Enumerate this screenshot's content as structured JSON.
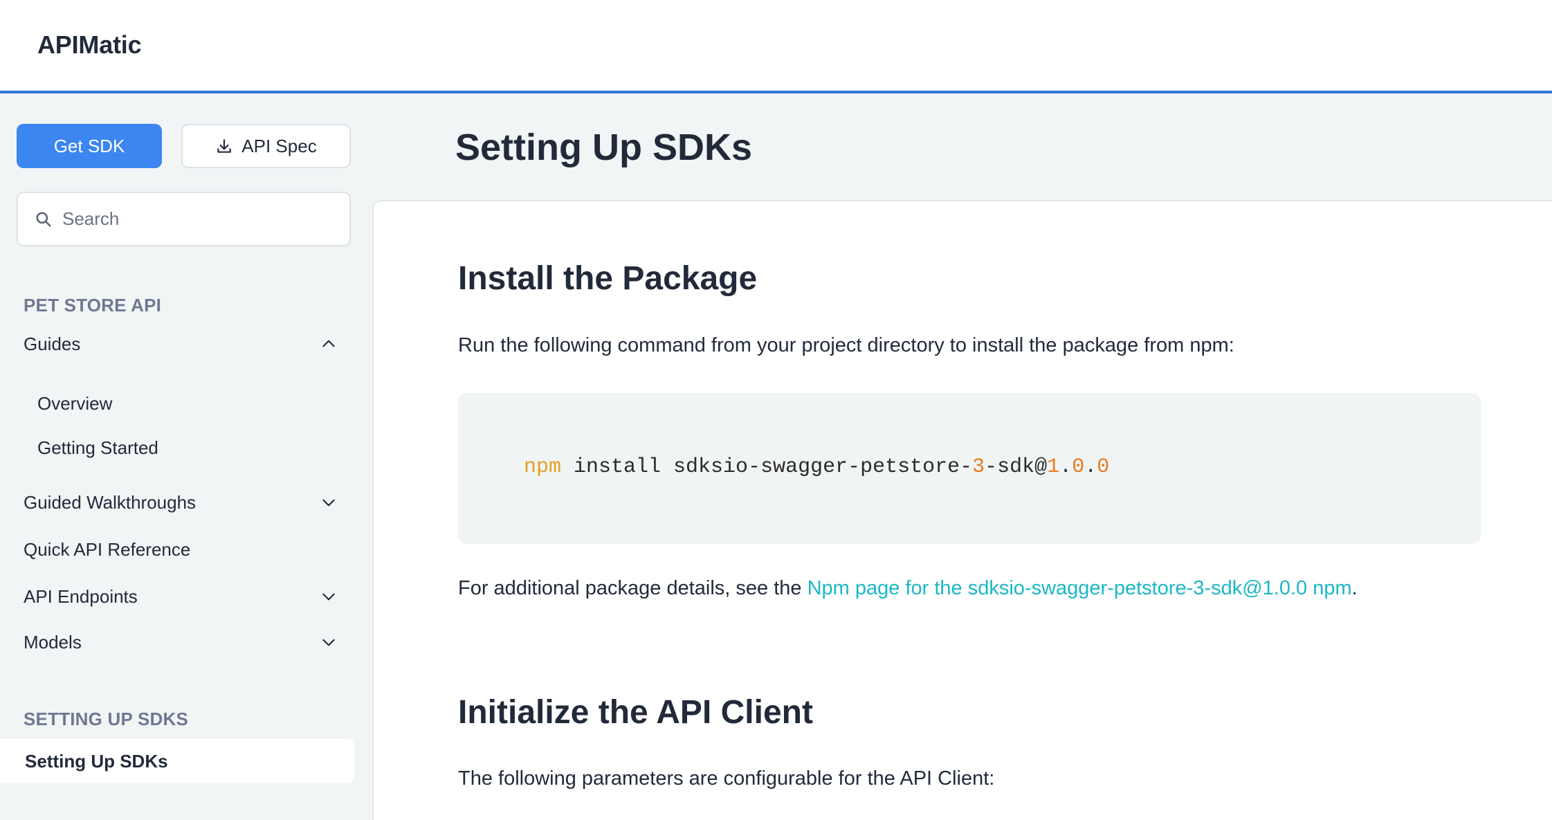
{
  "header": {
    "brand": "APIMatic"
  },
  "sidebar": {
    "get_sdk_label": "Get SDK",
    "api_spec_label": "API Spec",
    "search_placeholder": "Search",
    "section_pet_store": "PET STORE API",
    "guides": {
      "label": "Guides",
      "children": [
        "Overview",
        "Getting Started"
      ]
    },
    "guided_walkthroughs": "Guided Walkthroughs",
    "quick_api_reference": "Quick API Reference",
    "api_endpoints": "API Endpoints",
    "models": "Models",
    "section_setting_up": "SETTING UP SDKS",
    "active_item": "Setting Up SDKs"
  },
  "main": {
    "page_title": "Setting Up SDKs",
    "install_heading": "Install the Package",
    "install_text": "Run the following command from your project directory to install the package from npm:",
    "code": {
      "cmd": "npm",
      "text1": " install sdksio-swagger-petstore-",
      "n1": "3",
      "text2": "-sdk@",
      "n2": "1",
      "dot1": ".",
      "n3": "0",
      "dot2": ".",
      "n4": "0"
    },
    "details_prefix": "For additional package details, see the ",
    "details_link": "Npm page for the sdksio-swagger-petstore-3-sdk@1.0.0 npm",
    "details_suffix": ".",
    "init_heading": "Initialize the API Client",
    "init_text": "The following parameters are configurable for the API Client:"
  },
  "colors": {
    "accent": "#3b86f0",
    "header_border": "#2d76d6",
    "link": "#1ab8c7",
    "code_keyword": "#e6a020",
    "code_number": "#ec7a1c"
  }
}
